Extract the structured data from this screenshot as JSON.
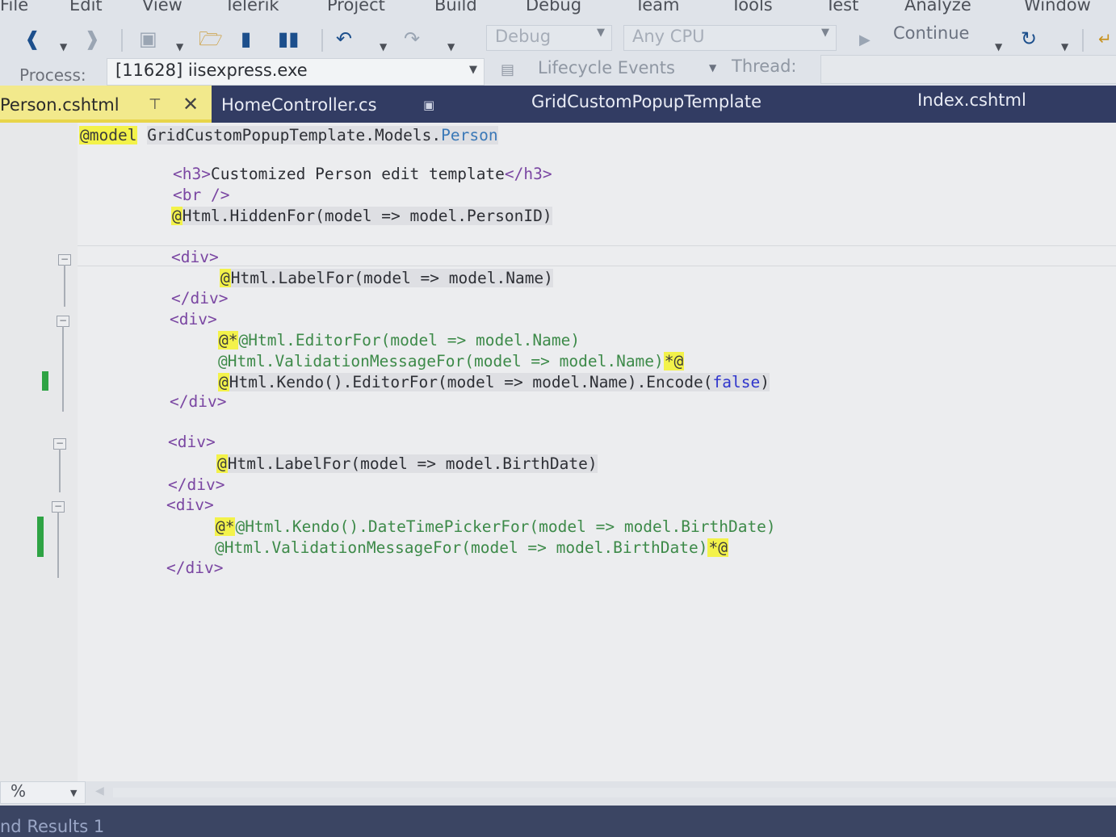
{
  "menu": [
    "File",
    "Edit",
    "View",
    "Telerik",
    "Project",
    "Build",
    "Debug",
    "Team",
    "Tools",
    "Test",
    "Analyze",
    "Window"
  ],
  "toolbar": {
    "config_value": "Debug",
    "platform_value": "Any CPU",
    "continue_label": "Continue",
    "icons": [
      "back-icon",
      "forward-icon",
      "new-project-icon",
      "open-icon",
      "save-icon",
      "save-all-icon",
      "undo-icon",
      "redo-icon",
      "continue-icon",
      "restart-icon"
    ]
  },
  "debugbar": {
    "process_label": "Process:",
    "process_value": "[11628] iisexpress.exe",
    "lifecycle_label": "Lifecycle Events",
    "thread_label": "Thread:"
  },
  "tabs": [
    {
      "label": "Person.cshtml",
      "active": true
    },
    {
      "label": "HomeController.cs",
      "active": false
    },
    {
      "label": "GridCustomPopupTemplate",
      "active": false
    },
    {
      "label": "Index.cshtml",
      "active": false
    }
  ],
  "code": {
    "l1_directive": "@model",
    "l1_ns": "GridCustomPopupTemplate.Models.",
    "l1_type": "Person",
    "l2_open": "<h3>",
    "l2_text": "Customized Person edit template",
    "l2_close": "</h3>",
    "l3": "<br />",
    "l4_at": "@",
    "l4_expr": "Html.HiddenFor(model => model.PersonID)",
    "div_open": "<div>",
    "div_close": "</div>",
    "l6_at": "@",
    "l6_expr": "Html.LabelFor(model => model.Name)",
    "l9_at": "@*",
    "l9_expr": "@Html.EditorFor(model => model.Name)",
    "l10_expr": "@Html.ValidationMessageFor(model => model.Name)",
    "l10_end": "*@",
    "l11_at": "@",
    "l11_expr": "Html.Kendo().EditorFor(model => model.Name).Encode(",
    "l11_kw": "false",
    "l11_close": ")",
    "l14_at": "@",
    "l14_expr": "Html.LabelFor(model => model.BirthDate)",
    "l17_at": "@*",
    "l17_expr": "@Html.Kendo().DateTimePickerFor(model => model.BirthDate)",
    "l18_expr": "@Html.ValidationMessageFor(model => model.BirthDate)",
    "l18_end": "*@"
  },
  "status": {
    "zoom": "%",
    "panel_title": "nd Results 1"
  },
  "colors": {
    "tab_bar": "#323c63",
    "active_tab": "#f2e98c",
    "razor_highlight": "#f3f24a",
    "html_tag": "#7a46a2",
    "keyword": "#2f35cc",
    "change_marker": "#2ea344"
  }
}
